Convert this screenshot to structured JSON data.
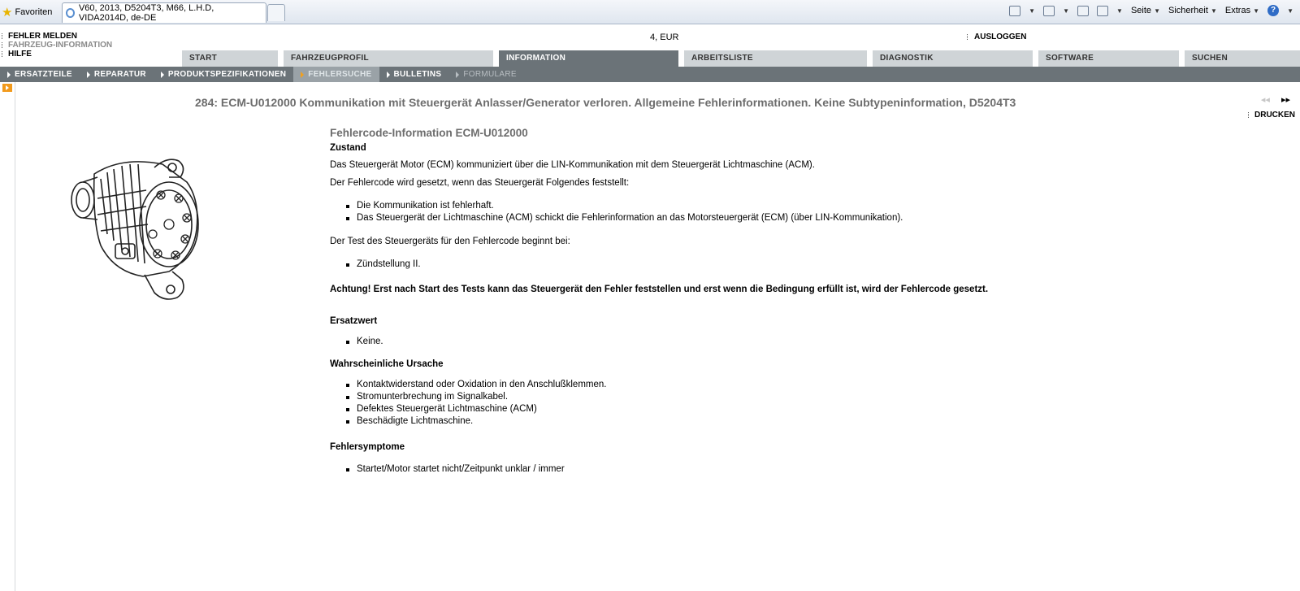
{
  "browser": {
    "favorites_label": "Favoriten",
    "tab_title": "V60, 2013, D5204T3, M66, L.H.D, VIDA2014D, de-DE",
    "commands": {
      "page": "Seite",
      "safety": "Sicherheit",
      "extras": "Extras"
    },
    "icons": [
      "home-icon",
      "feeds-icon",
      "mail-icon",
      "print-icon",
      "help-icon"
    ]
  },
  "header": {
    "links": [
      "FEHLER MELDEN",
      "FAHRZEUG-INFORMATION",
      "HILFE"
    ],
    "currency": "4, EUR",
    "logout": "AUSLOGGEN"
  },
  "tabs": [
    {
      "label": "START",
      "active": false
    },
    {
      "label": "FAHRZEUGPROFIL",
      "active": false
    },
    {
      "label": "INFORMATION",
      "active": true
    },
    {
      "label": "ARBEITSLISTE",
      "active": false
    },
    {
      "label": "DIAGNOSTIK",
      "active": false
    },
    {
      "label": "SOFTWARE",
      "active": false
    },
    {
      "label": "SUCHEN",
      "active": false
    }
  ],
  "subnav": [
    {
      "label": "ERSATZTEILE",
      "state": "normal"
    },
    {
      "label": "REPARATUR",
      "state": "normal"
    },
    {
      "label": "PRODUKTSPEZIFIKATIONEN",
      "state": "normal"
    },
    {
      "label": "FEHLERSUCHE",
      "state": "active"
    },
    {
      "label": "BULLETINS",
      "state": "normal"
    },
    {
      "label": "FORMULARE",
      "state": "disabled"
    }
  ],
  "document": {
    "title": "284: ECM-U012000 Kommunikation mit Steuergerät Anlasser/Generator verloren. Allgemeine Fehlerinformationen. Keine Subtypeninformation, D5204T3",
    "print": "DRUCKEN",
    "pager": {
      "prev": "◂◂",
      "next": "▸▸"
    },
    "heading": "Fehlercode-Information ECM-U012000",
    "zustand": {
      "title": "Zustand",
      "p1": "Das Steuergerät Motor (ECM) kommuniziert über die LIN-Kommunikation mit dem Steuergerät Lichtmaschine (ACM).",
      "p2": "Der Fehlercode wird gesetzt, wenn das Steuergerät Folgendes feststellt:",
      "list1": [
        "Die Kommunikation ist fehlerhaft.",
        "Das Steuergerät der Lichtmaschine (ACM) schickt die Fehlerinformation an das Motorsteuergerät (ECM) (über LIN-Kommunikation)."
      ],
      "p3": "Der Test des Steuergeräts für den Fehlercode beginnt bei:",
      "list2": [
        "Zündstellung II."
      ],
      "warning": "Achtung! Erst nach Start des Tests kann das Steuergerät den Fehler feststellen und erst wenn die Bedingung erfüllt ist, wird der Fehlercode gesetzt."
    },
    "ersatzwert": {
      "title": "Ersatzwert",
      "items": [
        "Keine."
      ]
    },
    "ursache": {
      "title": "Wahrscheinliche Ursache",
      "items": [
        "Kontaktwiderstand oder Oxidation in den Anschlußklemmen.",
        "Stromunterbrechung im Signalkabel.",
        "Defektes Steuergerät Lichtmaschine (ACM)",
        "Beschädigte Lichtmaschine."
      ]
    },
    "symptome": {
      "title": "Fehlersymptome",
      "items": [
        "Startet/Motor startet nicht/Zeitpunkt unklar / immer"
      ]
    }
  }
}
